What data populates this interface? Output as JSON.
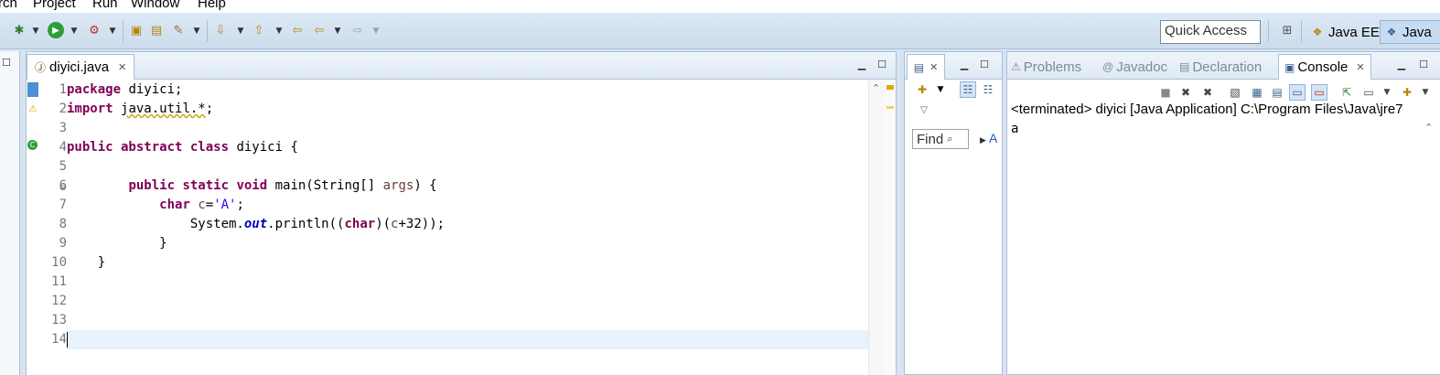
{
  "menu": [
    "rch",
    "Project",
    "Run",
    "Window",
    "Help"
  ],
  "toolbar": {
    "quick_access_placeholder": "Quick Access",
    "perspectives": [
      {
        "label": "Java EE",
        "active": false
      },
      {
        "label": "Java",
        "active": true
      }
    ]
  },
  "editor": {
    "tab_title": "diyici.java",
    "line_numbers": [
      "1",
      "2",
      "3",
      "4",
      "5",
      "6",
      "7",
      "8",
      "9",
      "10",
      "11",
      "12",
      "13",
      "14"
    ],
    "lines": [
      [
        {
          "t": "package",
          "k": "kw"
        },
        {
          "t": " diyici;",
          "k": ""
        }
      ],
      [
        {
          "t": "import",
          "k": "kw"
        },
        {
          "t": " ",
          "k": ""
        },
        {
          "t": "java.util.*",
          "k": "warn"
        },
        {
          "t": ";",
          "k": ""
        }
      ],
      [],
      [
        {
          "t": "public abstract class",
          "k": "kw"
        },
        {
          "t": " diyici {",
          "k": ""
        }
      ],
      [],
      [
        {
          "t": "        ",
          "k": ""
        },
        {
          "t": "public static void",
          "k": "kw"
        },
        {
          "t": " main(String[] ",
          "k": ""
        },
        {
          "t": "args",
          "k": "var"
        },
        {
          "t": ") {",
          "k": ""
        }
      ],
      [
        {
          "t": "            ",
          "k": ""
        },
        {
          "t": "char",
          "k": "kw"
        },
        {
          "t": " ",
          "k": ""
        },
        {
          "t": "c",
          "k": "var"
        },
        {
          "t": "=",
          "k": ""
        },
        {
          "t": "'A'",
          "k": "str"
        },
        {
          "t": ";",
          "k": ""
        }
      ],
      [
        {
          "t": "                System.",
          "k": ""
        },
        {
          "t": "out",
          "k": "fld"
        },
        {
          "t": ".println((",
          "k": ""
        },
        {
          "t": "char",
          "k": "kw"
        },
        {
          "t": ")(",
          "k": ""
        },
        {
          "t": "c",
          "k": "var"
        },
        {
          "t": "+32));",
          "k": ""
        }
      ],
      [
        {
          "t": "            }",
          "k": ""
        }
      ],
      [
        {
          "t": "    }",
          "k": ""
        }
      ],
      [],
      [],
      [],
      []
    ]
  },
  "outline": {
    "find_placeholder": "Find",
    "extra_label": "A"
  },
  "console": {
    "tabs": [
      {
        "label": "Problems",
        "active": false
      },
      {
        "label": "Javadoc",
        "active": false
      },
      {
        "label": "Declaration",
        "active": false
      },
      {
        "label": "Console",
        "active": true
      }
    ],
    "description": "<terminated> diyici [Java Application] C:\\Program Files\\Java\\jre7",
    "output": "a"
  },
  "colors": {
    "toolbar_bg": "#d3e2f1",
    "keyword": "#7f0055",
    "string": "#2a00ff",
    "static_field": "#0000c0",
    "local_var": "#6a3e3e",
    "current_line": "#e8f2fe",
    "line_number": "#787878"
  }
}
